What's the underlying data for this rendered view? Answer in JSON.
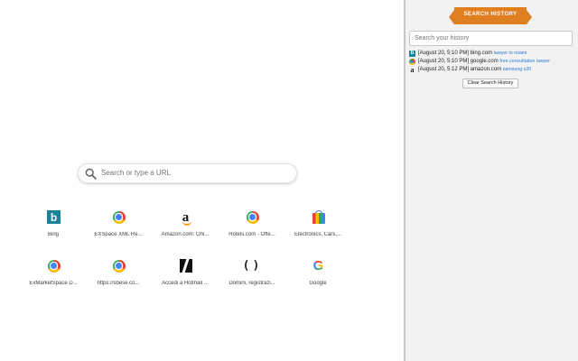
{
  "new_tab": {
    "search_placeholder": "Search or type a URL",
    "tiles": [
      {
        "label": "Bing",
        "icon": "bing-icon"
      },
      {
        "label": "EXSpace XML Re...",
        "icon": "chrome-icon"
      },
      {
        "label": "Amazon.com: Onl...",
        "icon": "amazon-icon"
      },
      {
        "label": "Hotels.com - Offe...",
        "icon": "chrome-icon"
      },
      {
        "label": "Electronics, Cars,...",
        "icon": "shopping-bag-icon"
      },
      {
        "label": "ExMarketSpace D...",
        "icon": "chrome-icon"
      },
      {
        "label": "https://sbese.co...",
        "icon": "chrome-icon"
      },
      {
        "label": "Accedi a Hotmail ...",
        "icon": "hotmail-icon"
      },
      {
        "label": "Domini, registrazi...",
        "icon": "parentheses-icon"
      },
      {
        "label": "Google",
        "icon": "google-icon"
      }
    ]
  },
  "history_panel": {
    "title": "Search History",
    "search_placeholder": "Search your history",
    "entries": [
      {
        "icon": "bing-icon",
        "time": "[August 20, 5:10 PM]",
        "site": "bing.com",
        "query": "lawyer in miami"
      },
      {
        "icon": "chrome-icon",
        "time": "[August 20, 5:10 PM]",
        "site": "google.com",
        "query": "free consultation lawyer"
      },
      {
        "icon": "amazon-icon",
        "time": "[August 20, 5:12 PM]",
        "site": "amazon.com",
        "query": "samsung s20"
      }
    ],
    "clear_label": "Clear Search History"
  },
  "colors": {
    "ribbon": "#e07f1f",
    "query_link": "#2a7bd4",
    "panel_bg": "#f2f2f2"
  }
}
